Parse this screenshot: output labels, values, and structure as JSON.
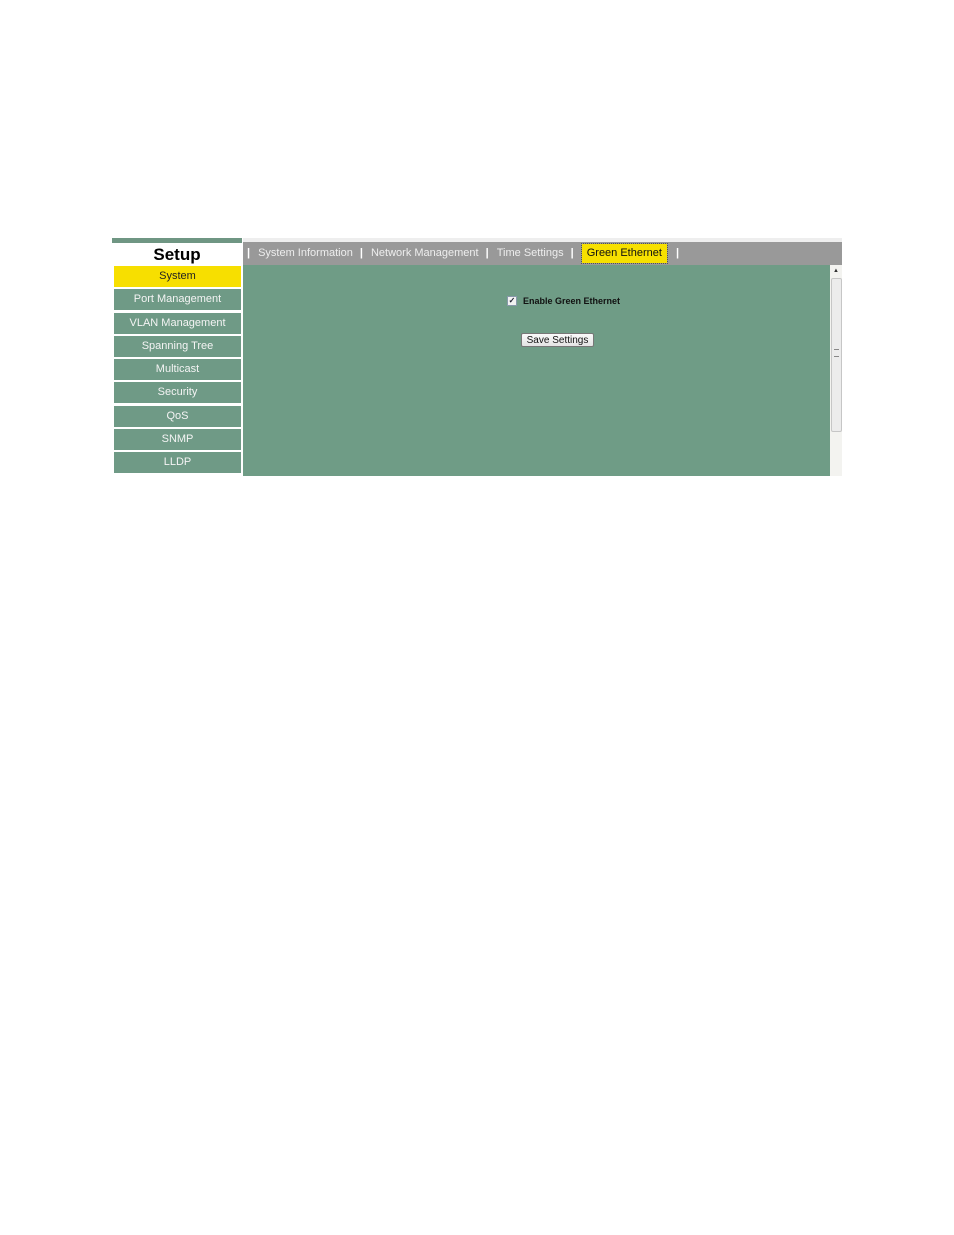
{
  "sidebar": {
    "title": "Setup",
    "items": [
      {
        "label": "System",
        "active": true
      },
      {
        "label": "Port Management"
      },
      {
        "label": "VLAN Management"
      },
      {
        "label": "Spanning Tree"
      },
      {
        "label": "Multicast"
      },
      {
        "label": "Security"
      },
      {
        "label": "QoS"
      },
      {
        "label": "SNMP"
      },
      {
        "label": "LLDP"
      }
    ]
  },
  "tabs": {
    "separator": "|",
    "items": [
      {
        "label": "System Information"
      },
      {
        "label": "Network Management"
      },
      {
        "label": "Time Settings"
      },
      {
        "label": "Green Ethernet",
        "active": true
      }
    ]
  },
  "main": {
    "enable_checkbox": {
      "label": "Enable Green Ethernet",
      "checked": true,
      "mark": "✓"
    },
    "save_button": "Save Settings"
  },
  "colors": {
    "accent_yellow": "#f7df00",
    "panel_green": "#6f9c86",
    "tabbar_gray": "#999999"
  }
}
